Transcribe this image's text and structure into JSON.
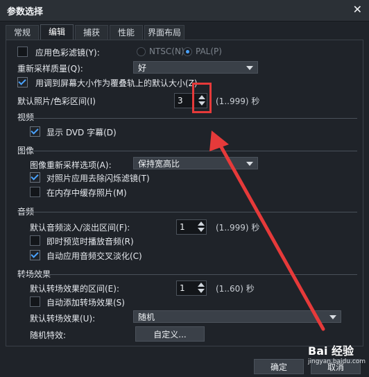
{
  "window": {
    "title": "参数选择"
  },
  "tabs": [
    "常规",
    "编辑",
    "捕获",
    "性能",
    "界面布局"
  ],
  "options": {
    "color_filter": {
      "label": "应用色彩滤镜(Y):",
      "checked": false
    },
    "video_standard": {
      "ntsc": "NTSC(N)",
      "pal": "PAL(P)",
      "selected": "pal"
    },
    "resample_quality": {
      "label": "重新采样质量(Q):",
      "value": "好"
    },
    "fit_overlay": {
      "label": "用调到屏幕大小作为覆叠轨上的默认大小(Z)",
      "checked": true
    },
    "photo_duration": {
      "label": "默认照片/色彩区间(I)",
      "value": "3",
      "hint": "(1..999) 秒"
    }
  },
  "sections": {
    "video": {
      "title": "视频",
      "dvd_subtitle": {
        "label": "显示 DVD 字幕(D)",
        "checked": true
      }
    },
    "image": {
      "title": "图像",
      "resample_option": {
        "label": "图像重新采样选项(A):",
        "value": "保持宽高比"
      },
      "deflicker": {
        "label": "对照片应用去除闪烁滤镜(T)",
        "checked": true
      },
      "cache_photos": {
        "label": "在内存中缓存照片(M)",
        "checked": false
      }
    },
    "audio": {
      "title": "音频",
      "fade": {
        "label": "默认音频淡入/淡出区间(F):",
        "value": "1",
        "hint": "(1..999) 秒"
      },
      "instant_preview": {
        "label": "即时预览时播放音频(R)",
        "checked": false
      },
      "auto_crossfade": {
        "label": "自动应用音频交叉淡化(C)",
        "checked": true
      }
    },
    "transition": {
      "title": "转场效果",
      "duration": {
        "label": "默认转场效果的区间(E):",
        "value": "1",
        "hint": "(1..60) 秒"
      },
      "auto_add": {
        "label": "自动添加转场效果(S)",
        "checked": false
      },
      "default_effect": {
        "label": "默认转场效果(U):",
        "value": "随机"
      },
      "random_effects": {
        "label": "随机特效:",
        "button": "自定义..."
      }
    }
  },
  "buttons": {
    "ok": "确定",
    "cancel": "取消"
  },
  "watermark": {
    "brand": "Bai 经验",
    "url": "jingyan.baidu.com"
  },
  "colors": {
    "background": "#1f2329",
    "accent": "#4aa3ff",
    "annotation": "#e63a3a"
  }
}
